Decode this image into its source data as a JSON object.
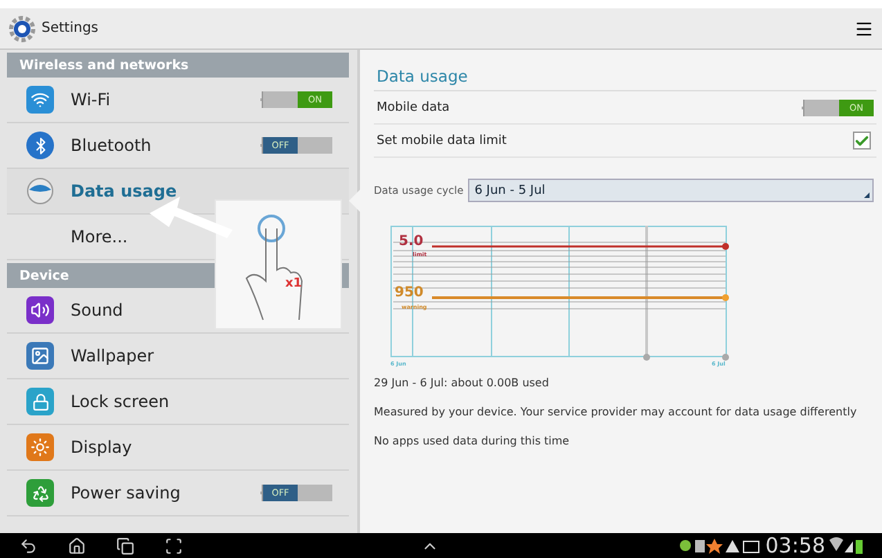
{
  "window": {
    "title": "Settings"
  },
  "sidebar": {
    "sections": [
      {
        "header": "Wireless and networks",
        "items": [
          {
            "label": "Wi-Fi",
            "kind": "toggle",
            "on": true,
            "switch_label": "ON",
            "selected": false
          },
          {
            "label": "Bluetooth",
            "kind": "toggle",
            "on": false,
            "switch_label": "OFF",
            "selected": false
          },
          {
            "label": "Data usage",
            "kind": "plain",
            "selected": true
          },
          {
            "label": "More...",
            "kind": "plain",
            "selected": false
          }
        ]
      },
      {
        "header": "Device",
        "items": [
          {
            "label": "Sound",
            "kind": "plain",
            "selected": false
          },
          {
            "label": "Wallpaper",
            "kind": "plain",
            "selected": false
          },
          {
            "label": "Lock screen",
            "kind": "plain",
            "selected": false
          },
          {
            "label": "Display",
            "kind": "plain",
            "selected": false
          },
          {
            "label": "Power saving",
            "kind": "toggle",
            "on": false,
            "switch_label": "OFF",
            "selected": false
          }
        ]
      }
    ]
  },
  "tutorial": {
    "tap_count": "x1"
  },
  "detail": {
    "title": "Data usage",
    "mobile_data": {
      "label": "Mobile data",
      "on": true,
      "switch_label": "ON"
    },
    "limit": {
      "label": "Set mobile data limit",
      "checked": true
    },
    "cycle": {
      "label": "Data usage cycle",
      "value": "6 Jun - 5 Jul"
    },
    "chart": {
      "limit_value": "5.0",
      "limit_label": "limit",
      "warning_value": "950",
      "warning_label": "warning",
      "start": "6 Jun",
      "end": "6 Jul"
    },
    "lines": [
      "29 Jun - 6 Jul: about 0.00B used",
      "Measured by your device. Your service provider may account for data usage differently",
      "No apps used data during this time"
    ]
  },
  "status_bar": {
    "time": "03:58"
  }
}
